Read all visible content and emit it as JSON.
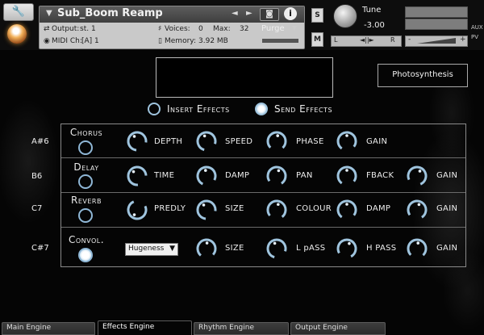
{
  "header": {
    "instrument_name": "Sub_Boom Reamp",
    "output_label": "Output:",
    "output_value": "st. 1",
    "midi_label": "MIDI Ch:",
    "midi_value": "[A]  1",
    "voices_label": "Voices:",
    "voices_value": "0",
    "max_label": "Max:",
    "max_value": "32",
    "memory_label": "Memory:",
    "memory_value": "3.92 MB",
    "purge_label": "Purge",
    "solo_label": "S",
    "mute_label": "M",
    "tune_label": "Tune",
    "tune_value": "-3.00",
    "pan_left": "L",
    "pan_center": "◄||►",
    "pan_right": "R",
    "aux_label": "AUX",
    "pv_label": "PV",
    "vol_minus": "-",
    "vol_plus": "+"
  },
  "preset_name": "Photosynthesis",
  "effect_modes": [
    {
      "label": "Insert Effects",
      "selected": false
    },
    {
      "label": "Send Effects",
      "selected": true
    }
  ],
  "effects": [
    {
      "note": "A#6",
      "name": "Chorus",
      "enabled": false,
      "params": [
        "DEPTH",
        "SPEED",
        "PHASE",
        "GAIN"
      ]
    },
    {
      "note": "B6",
      "name": "Delay",
      "enabled": false,
      "params": [
        "TIME",
        "DAMP",
        "PAN",
        "FBACK",
        "GAIN"
      ]
    },
    {
      "note": "C7",
      "name": "Reverb",
      "enabled": false,
      "params": [
        "PREDLY",
        "SIZE",
        "COLOUR",
        "DAMP",
        "GAIN"
      ]
    },
    {
      "note": "C#7",
      "name": "Convol.",
      "enabled": true,
      "dropdown_value": "Hugeness",
      "params": [
        "SIZE",
        "L pASS",
        "H PASS",
        "GAIN"
      ]
    }
  ],
  "tabs": [
    {
      "label": "Main Engine",
      "active": false
    },
    {
      "label": "Effects Engine",
      "active": true
    },
    {
      "label": "Rhythm Engine",
      "active": false
    },
    {
      "label": "Output Engine",
      "active": false
    }
  ],
  "icons": {
    "settings": "wrench-icon",
    "snapshot": "camera-icon",
    "info": "info-icon"
  },
  "colors": {
    "accent": "#9fc4de",
    "background": "#050505"
  }
}
